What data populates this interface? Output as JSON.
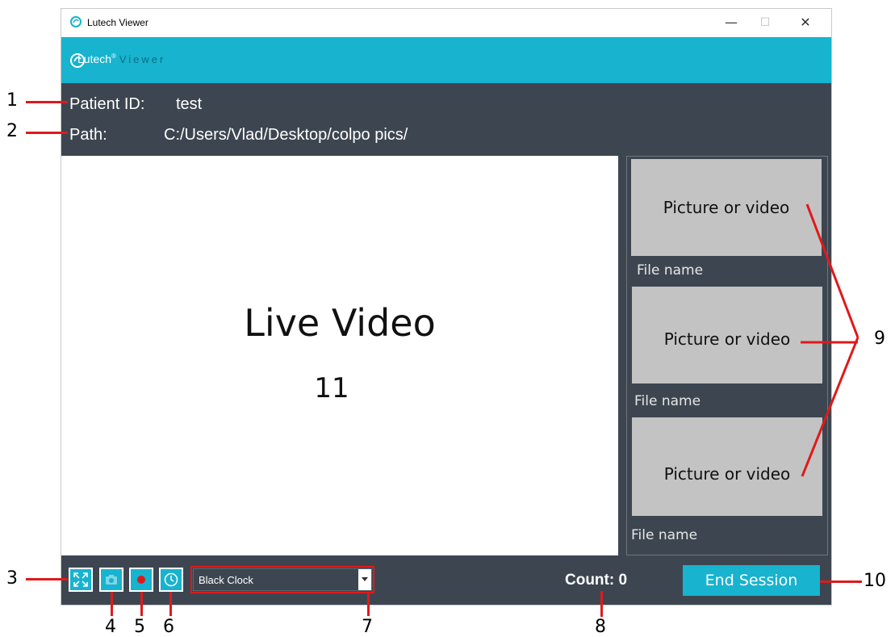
{
  "window": {
    "title": "Lutech Viewer",
    "minimize": "—",
    "maximize": "☐",
    "close": "✕"
  },
  "brand": {
    "name": "Lutech",
    "suffix": "Viewer"
  },
  "info": {
    "patient_label": "Patient ID:",
    "patient_value": "test",
    "path_label": "Path:",
    "path_value": "C:/Users/Vlad/Desktop/colpo pics/"
  },
  "video": {
    "title": "Live Video",
    "counter": "11"
  },
  "thumbnails": [
    {
      "label": "Picture or video",
      "file_name": "File name"
    },
    {
      "label": "Picture or video",
      "file_name": "File name"
    },
    {
      "label": "Picture or video",
      "file_name": "File name"
    }
  ],
  "toolbar": {
    "clock_select_value": "Black Clock",
    "count_label": "Count: 0",
    "end_session": "End Session"
  },
  "annotations": {
    "n1": "1",
    "n2": "2",
    "n3": "3",
    "n4": "4",
    "n5": "5",
    "n6": "6",
    "n7": "7",
    "n8": "8",
    "n9": "9",
    "n10": "10"
  },
  "colors": {
    "accent": "#17b3cf",
    "panel": "#3d4650",
    "annotation": "#e0191b"
  }
}
